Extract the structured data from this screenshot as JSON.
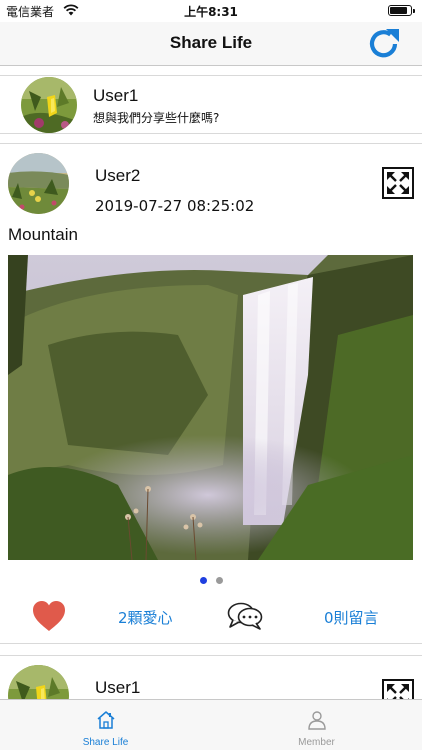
{
  "status_bar": {
    "carrier": "電信業者",
    "time": "上午8:31"
  },
  "nav": {
    "title": "Share Life"
  },
  "colors": {
    "accent": "#1a7fd6",
    "heart": "#e05a4b",
    "tab_active": "#1a7fd6",
    "tab_inactive": "#9a9a9a",
    "dot_active": "#1f3fe0",
    "dot_inactive": "#9a9a9a"
  },
  "compose": {
    "user": "User1",
    "prompt": "想與我們分享些什麼嗎?"
  },
  "posts": [
    {
      "user": "User2",
      "time": "2019-07-27 08:25:02",
      "caption": "Mountain",
      "photo_pages": 2,
      "active_page": 1,
      "likes_label": "2顆愛心",
      "comments_label": "0則留言"
    },
    {
      "user": "User1"
    }
  ],
  "tabs": [
    {
      "label": "Share Life",
      "icon": "home-icon",
      "active": true
    },
    {
      "label": "Member",
      "icon": "person-icon",
      "active": false
    }
  ]
}
